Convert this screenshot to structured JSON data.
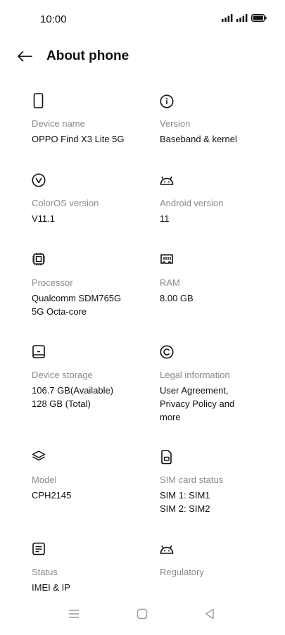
{
  "status_bar": {
    "time": "10:00",
    "icons": [
      "signal-icon",
      "signal-icon",
      "battery-icon"
    ]
  },
  "header": {
    "title": "About phone",
    "back_icon": "arrow-left-icon"
  },
  "items": [
    {
      "icon": "phone-icon",
      "title": "Device name",
      "value": "OPPO Find X3 Lite 5G"
    },
    {
      "icon": "info-icon",
      "title": "Version",
      "value": "Baseband & kernel"
    },
    {
      "icon": "coloros-icon",
      "title": "ColorOS version",
      "value": "V11.1"
    },
    {
      "icon": "android-icon",
      "title": "Android version",
      "value": "11"
    },
    {
      "icon": "processor-icon",
      "title": "Processor",
      "value": "Qualcomm  SDM765G\n5G Octa-core"
    },
    {
      "icon": "ram-icon",
      "title": "RAM",
      "value": "8.00 GB"
    },
    {
      "icon": "storage-icon",
      "title": "Device storage",
      "value": "106.7 GB(Available)\n128 GB (Total)"
    },
    {
      "icon": "copyright-icon",
      "title": "Legal information",
      "value": "User Agreement,\nPrivacy Policy and\nmore"
    },
    {
      "icon": "layers-icon",
      "title": "Model",
      "value": "CPH2145"
    },
    {
      "icon": "sim-card-icon",
      "title": "SIM card status",
      "value": "SIM 1: SIM1\nSIM 2: SIM2"
    },
    {
      "icon": "document-icon",
      "title": "Status",
      "value": "IMEI & IP"
    },
    {
      "icon": "android-icon",
      "title": "Regulatory",
      "value": ""
    }
  ],
  "nav_bar": {
    "icons": [
      "menu-icon",
      "home-icon",
      "back-triangle-icon"
    ]
  },
  "colors": {
    "text_primary": "#111111",
    "text_secondary": "#8a8a8a",
    "nav_icon": "#9a9a9a",
    "background": "#ffffff"
  }
}
